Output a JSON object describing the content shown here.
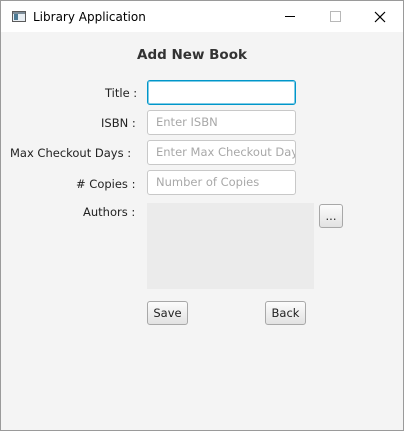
{
  "window": {
    "title": "Library Application"
  },
  "form": {
    "heading": "Add New Book",
    "title_label": "Title :",
    "title_value": "",
    "isbn_label": "ISBN :",
    "isbn_placeholder": "Enter ISBN",
    "max_days_label": "Max Checkout Days :",
    "max_days_placeholder": "Enter Max Checkout Days",
    "copies_label": "# Copies :",
    "copies_placeholder": "Number of Copies",
    "authors_label": "Authors :",
    "authors_button": "...",
    "save_label": "Save",
    "back_label": "Back"
  }
}
